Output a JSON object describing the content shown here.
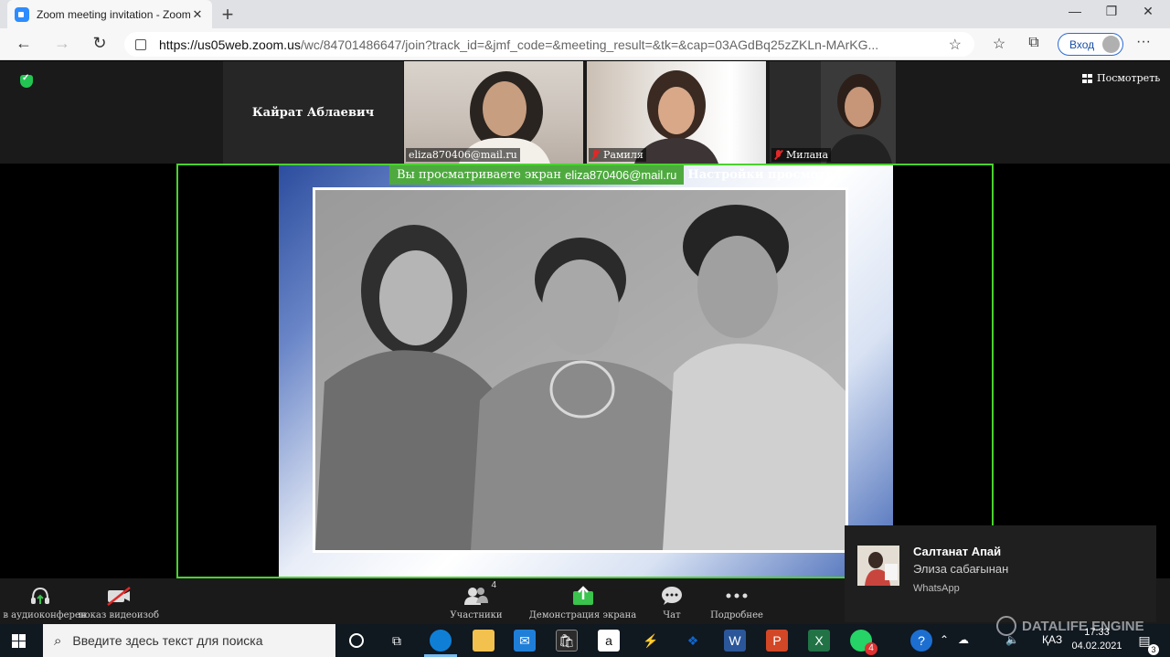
{
  "browser": {
    "tab_title": "Zoom meeting invitation - Zoom",
    "tab_close": "✕",
    "new_tab": "+",
    "window_controls": {
      "minimize": "—",
      "maximize": "❐",
      "close": "✕"
    },
    "nav": {
      "back": "←",
      "forward": "→",
      "reload": "↻"
    },
    "url_host": "https://us05web.zoom.us",
    "url_rest": "/wc/84701486647/join?track_id=&jmf_code=&meeting_result=&tk=&cap=03AGdBq25zZKLn-MArKG...",
    "favorite_icon": "☆",
    "signin_label": "Вход",
    "more": "···"
  },
  "meeting": {
    "host_name": "Кайрат Аблаевич",
    "participants": [
      {
        "label": "eliza870406@mail.ru",
        "muted": false
      },
      {
        "label": "Рамиля",
        "muted": true
      },
      {
        "label": "Милана",
        "muted": true
      }
    ],
    "view_button": "Посмотреть",
    "share_banner": {
      "prefix": "Вы просматриваете экран",
      "email": "eliza870406@mail.ru",
      "options": "Настройки просмотра"
    }
  },
  "footer": {
    "audio_label": "и в аудиоконферен",
    "video_label": "показ видеоизоб",
    "participants_label": "Участники",
    "participants_count": "4",
    "share_label": "Демонстрация экрана",
    "chat_label": "Чат",
    "more_label": "Подробнее"
  },
  "notification": {
    "title": "Салтанат Апай",
    "message": "Элиза сабағынан",
    "app": "WhatsApp"
  },
  "taskbar": {
    "search_placeholder": "Введите здесь текст для поиска",
    "lang": "ҚАЗ",
    "time": "17:33",
    "date": "04.02.2021",
    "whatsapp_badge": "4",
    "notif_count": "3"
  },
  "watermark": "DATALIFE ENGINE"
}
